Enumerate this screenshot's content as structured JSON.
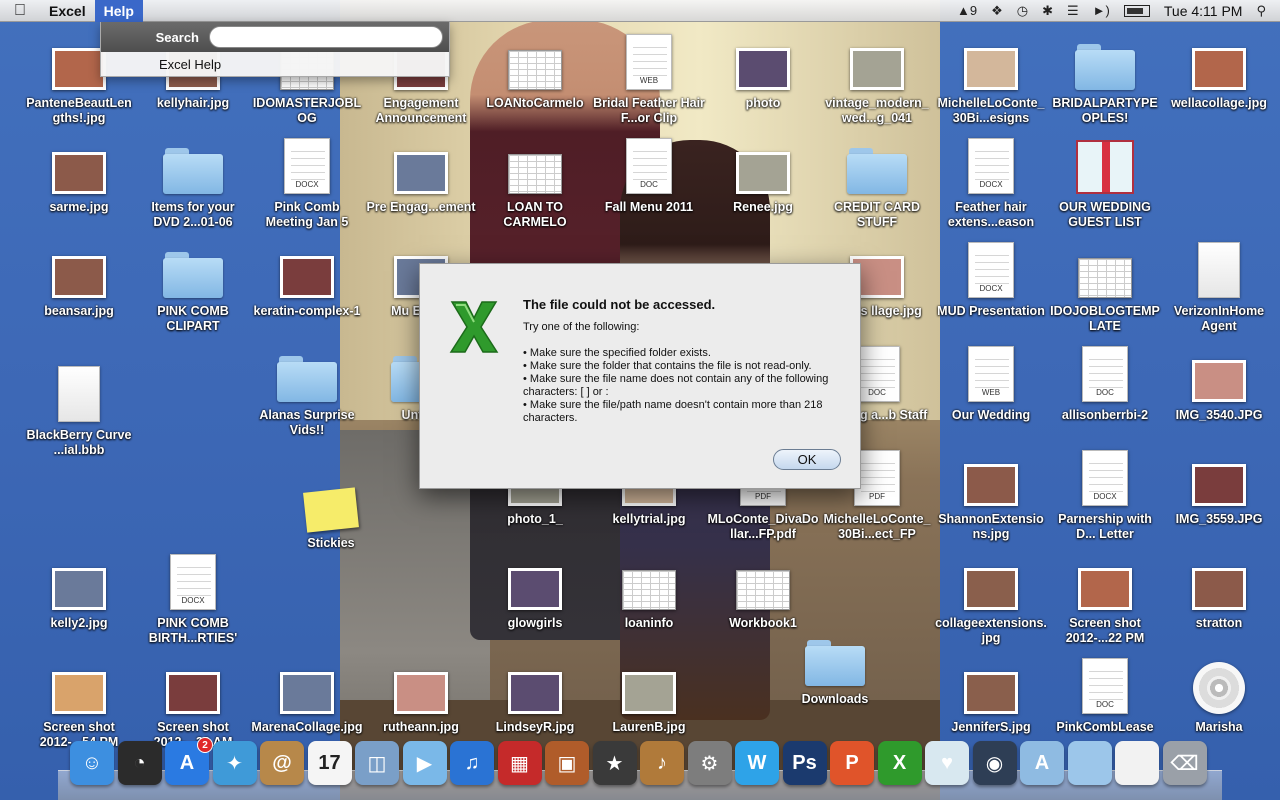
{
  "menubar": {
    "app": "Excel",
    "menus": [
      "Help"
    ],
    "status": {
      "badge_count": "9",
      "time": "Tue 4:11 PM"
    }
  },
  "help_menu": {
    "search_label": "Search",
    "search_value": "",
    "item": "Excel Help"
  },
  "dialog": {
    "title": "The file could not be accessed.",
    "intro": "Try one of the following:",
    "bullets": [
      "• Make sure the specified folder exists.",
      "• Make sure the folder that contains the file is not read-only.",
      "• Make sure the file name does not contain any of the following characters:  [  ]  or :",
      "• Make sure the file/path name doesn't contain more than 218 characters."
    ],
    "ok_label": "OK"
  },
  "desktop_icons": [
    {
      "label": "PanteneBeautLengths!.jpg",
      "kind": "photo"
    },
    {
      "label": "kellyhair.jpg",
      "kind": "photo"
    },
    {
      "label": "IDOMASTERJOBLOG",
      "kind": "sheet",
      "tag": "XLSX"
    },
    {
      "label": "Engagement Announcement",
      "kind": "photo"
    },
    {
      "label": "LOANtoCarmelo",
      "kind": "sheet",
      "tag": "XLSX"
    },
    {
      "label": "Bridal Feather Hair F...or Clip",
      "kind": "doc",
      "tag": "WEB"
    },
    {
      "label": "photo",
      "kind": "photo"
    },
    {
      "label": "vintage_modern_wed...g_041",
      "kind": "photo"
    },
    {
      "label": "MichelleLoConte_30Bi...esigns",
      "kind": "photo"
    },
    {
      "label": "BRIDALPARTYPEOPLES!",
      "kind": "folder"
    },
    {
      "label": "wellacollage.jpg",
      "kind": "photo"
    },
    {
      "label": "sarme.jpg",
      "kind": "photo"
    },
    {
      "label": "Items for your DVD 2...01-06",
      "kind": "folder"
    },
    {
      "label": "Pink Comb Meeting Jan 5",
      "kind": "doc",
      "tag": "DOCX"
    },
    {
      "label": "Pre Engag...ement",
      "kind": "photo"
    },
    {
      "label": "LOAN TO CARMELO",
      "kind": "sheet",
      "tag": "XLSX"
    },
    {
      "label": "Fall Menu 2011",
      "kind": "doc",
      "tag": "DOC"
    },
    {
      "label": "Renee.jpg",
      "kind": "photo"
    },
    {
      "label": "CREDIT CARD STUFF",
      "kind": "folder"
    },
    {
      "label": "Feather hair extens...eason",
      "kind": "doc",
      "tag": "DOCX"
    },
    {
      "label": "OUR WEDDING GUEST LIST",
      "kind": "gift"
    },
    {
      "label": "beansar.jpg",
      "kind": "photo"
    },
    {
      "label": "PINK COMB CLIPART",
      "kind": "folder"
    },
    {
      "label": "keratin-complex-1",
      "kind": "photo"
    },
    {
      "label": "Mu Engag",
      "kind": "photo"
    },
    {
      "label": "Maids llage.jpg",
      "kind": "photo"
    },
    {
      "label": "MUD Presentation",
      "kind": "doc",
      "tag": "DOCX"
    },
    {
      "label": "IDOJOBLOGTEMPLATE",
      "kind": "sheet",
      "tag": "XLSX"
    },
    {
      "label": "VerizonInHome Agent",
      "kind": "blank"
    },
    {
      "label": "BlackBerry Curve ...ial.bbb",
      "kind": "blank"
    },
    {
      "label": "Alanas Surprise Vids!!",
      "kind": "folder"
    },
    {
      "label": "Untitle",
      "kind": "folder"
    },
    {
      "label": "edding a...b Staff",
      "kind": "doc",
      "tag": "DOC"
    },
    {
      "label": "Our Wedding",
      "kind": "doc",
      "tag": "WEB"
    },
    {
      "label": "allisonberrbi-2",
      "kind": "doc",
      "tag": "DOC"
    },
    {
      "label": "IMG_3540.JPG",
      "kind": "photo"
    },
    {
      "label": "Stickies",
      "kind": "note"
    },
    {
      "label": "photo_1_",
      "kind": "photo"
    },
    {
      "label": "kellytrial.jpg",
      "kind": "photo"
    },
    {
      "label": "MLoConte_DivaDollar...FP.pdf",
      "kind": "doc",
      "tag": "PDF"
    },
    {
      "label": "MichelleLoConte_30Bi...ect_FP",
      "kind": "doc",
      "tag": "PDF"
    },
    {
      "label": "ShannonExtensions.jpg",
      "kind": "photo"
    },
    {
      "label": "Parnership with D... Letter",
      "kind": "doc",
      "tag": "DOCX"
    },
    {
      "label": "IMG_3559.JPG",
      "kind": "photo"
    },
    {
      "label": "kelly2.jpg",
      "kind": "photo"
    },
    {
      "label": "PINK COMB BIRTH...RTIES'",
      "kind": "doc",
      "tag": "DOCX"
    },
    {
      "label": "glowgirls",
      "kind": "photo"
    },
    {
      "label": "loaninfo",
      "kind": "sheet",
      "tag": "XLSX"
    },
    {
      "label": "Workbook1",
      "kind": "sheet",
      "tag": "XLSX"
    },
    {
      "label": "collageextensions.jpg",
      "kind": "photo"
    },
    {
      "label": "Screen shot 2012-...22 PM",
      "kind": "photo"
    },
    {
      "label": "stratton",
      "kind": "photo"
    },
    {
      "label": "Screen shot 2012-...54 PM",
      "kind": "photo"
    },
    {
      "label": "Screen shot 2012-...36 AM",
      "kind": "photo"
    },
    {
      "label": "MarenaCollage.jpg",
      "kind": "photo"
    },
    {
      "label": "rutheann.jpg",
      "kind": "photo"
    },
    {
      "label": "LindseyR.jpg",
      "kind": "photo"
    },
    {
      "label": "LaurenB.jpg",
      "kind": "photo"
    },
    {
      "label": "Downloads",
      "kind": "folder"
    },
    {
      "label": "JenniferS.jpg",
      "kind": "photo"
    },
    {
      "label": "PinkCombLease",
      "kind": "doc",
      "tag": "DOC"
    },
    {
      "label": "Marisha",
      "kind": "cd"
    }
  ],
  "dock": {
    "app_store_badge": "2",
    "calendar_day": "17",
    "items": [
      "finder",
      "dashboard",
      "app-store",
      "safari",
      "address-book",
      "calendar",
      "preview",
      "facetime",
      "itunes",
      "photo-booth",
      "iphoto",
      "imovie",
      "garageband",
      "system-preferences",
      "word",
      "photoshop",
      "powerpoint",
      "excel",
      "gift",
      "time-machine",
      "applications-stack",
      "documents-stack",
      "document-stack",
      "trash"
    ]
  },
  "colors": {
    "desktop": "#3d68b6",
    "menu_highlight": "#3a68c9",
    "excel_green": "#2f9a2c"
  }
}
